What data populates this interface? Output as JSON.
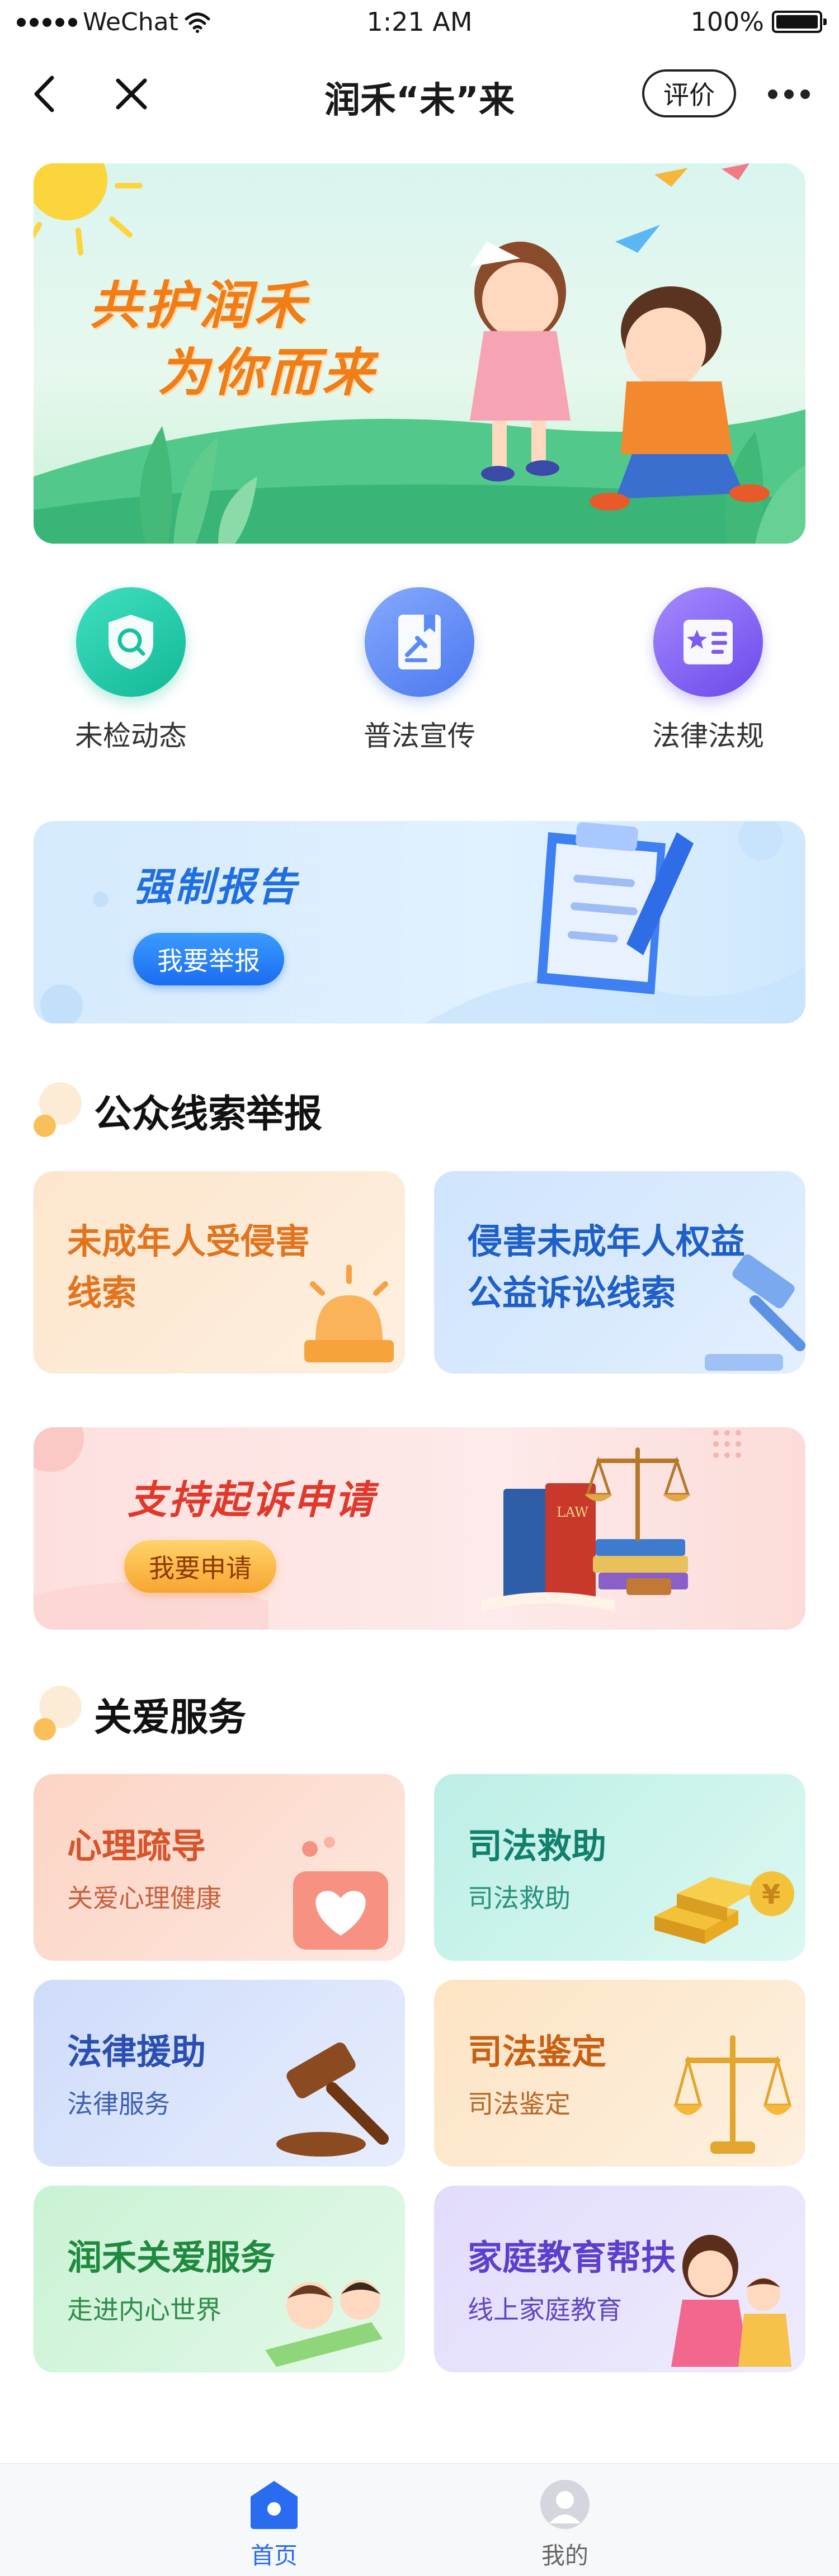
{
  "status_bar": {
    "carrier": "WeChat",
    "time": "1:21 AM",
    "battery": "100%",
    "battery_level": 1.0
  },
  "nav": {
    "title": "润禾“未”来",
    "rate_label": "评价"
  },
  "hero": {
    "line1": "共护润禾",
    "line2": "为你而来"
  },
  "quick_entries": [
    {
      "label": "未检动态",
      "icon": "shield-search-icon",
      "color": "#1fcfae"
    },
    {
      "label": "普法宣传",
      "icon": "book-gavel-icon",
      "color": "#5b8cf5"
    },
    {
      "label": "法律法规",
      "icon": "star-book-icon",
      "color": "#7a5cf0"
    }
  ],
  "report_banner": {
    "title": "强制报告",
    "button": "我要举报"
  },
  "clue_section": {
    "title": "公众线索举报",
    "cards": [
      {
        "line1": "未成年人受侵害",
        "line2": "线索",
        "color": "#e3741e"
      },
      {
        "line1": "侵害未成年人权益",
        "line2": "公益诉讼线索",
        "color": "#1e5fc8"
      }
    ]
  },
  "litigation_banner": {
    "title": "支持起诉申请",
    "button": "我要申请",
    "book_label": "LAW"
  },
  "care_section": {
    "title": "关爱服务",
    "cards": [
      {
        "title": "心理疏导",
        "subtitle": "关爱心理健康",
        "icon": "heart-chat-icon"
      },
      {
        "title": "司法救助",
        "subtitle": "司法救助",
        "icon": "gold-bars-icon"
      },
      {
        "title": "法律援助",
        "subtitle": "法律服务",
        "icon": "gavel-icon"
      },
      {
        "title": "司法鉴定",
        "subtitle": "司法鉴定",
        "icon": "scales-icon"
      },
      {
        "title": "润禾关爱服务",
        "subtitle": "走进内心世界",
        "icon": "kids-pencil-icon"
      },
      {
        "title": "家庭教育帮扶",
        "subtitle": "线上家庭教育",
        "icon": "parent-child-icon"
      }
    ]
  },
  "tab_bar": {
    "tabs": [
      {
        "label": "首页",
        "icon": "home-icon",
        "active": true
      },
      {
        "label": "我的",
        "icon": "profile-icon",
        "active": false
      }
    ]
  }
}
